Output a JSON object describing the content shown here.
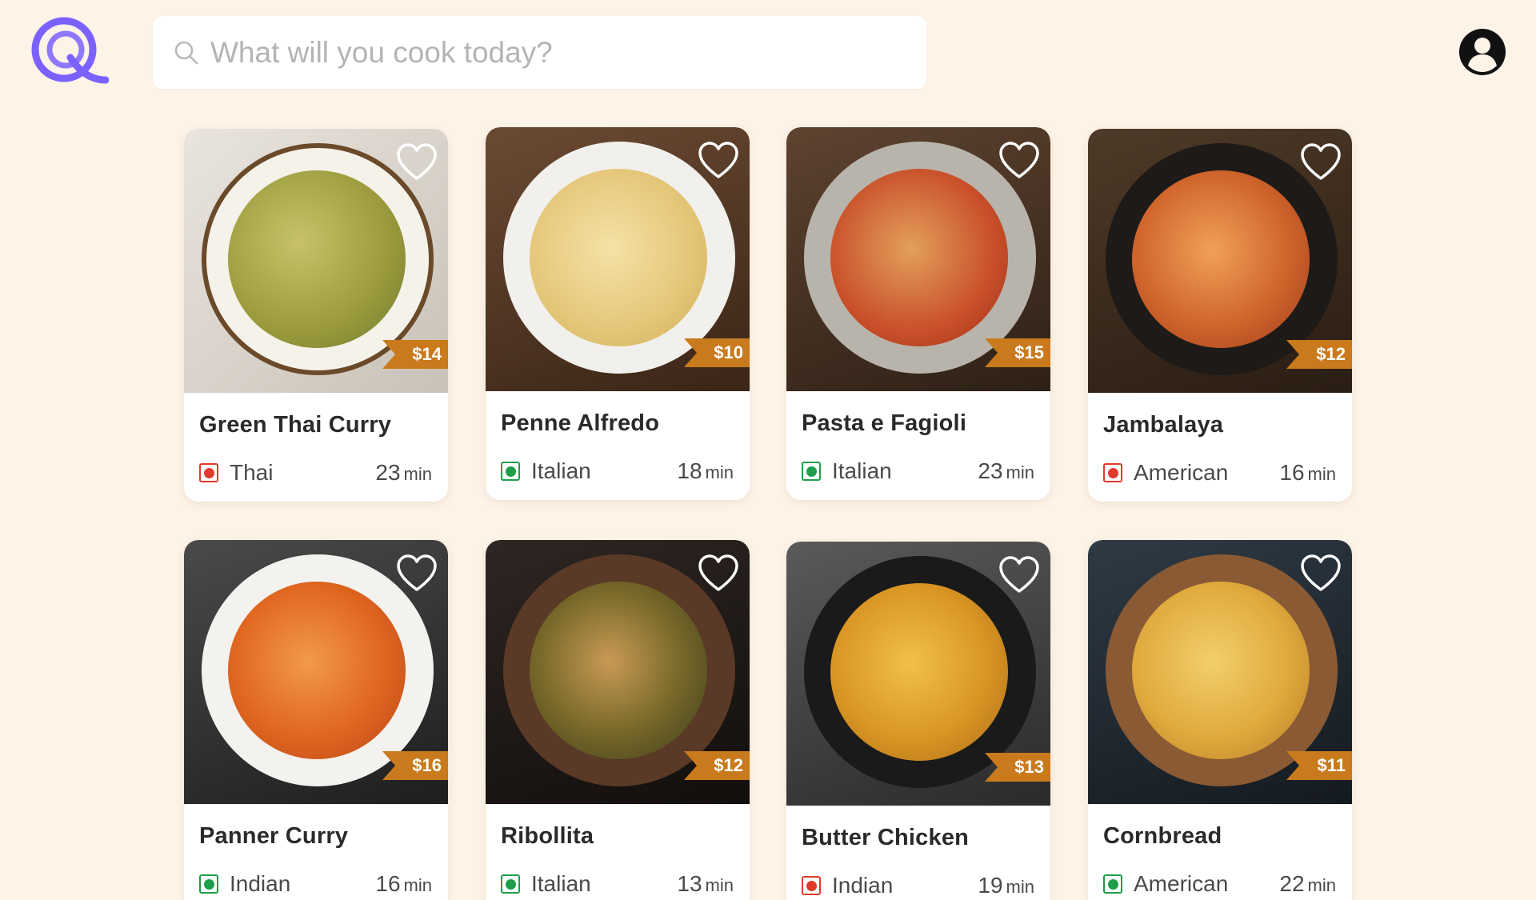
{
  "header": {
    "logo_icon": "q-logo-icon",
    "search": {
      "placeholder": "What will you cook today?",
      "icon": "search-icon"
    },
    "account_icon": "user-account-icon"
  },
  "colors": {
    "background": "#fdf3e7",
    "brand": "#7b61ff",
    "price_tag": "#c97a1c",
    "veg": "#1e9e4a",
    "non_veg": "#e03a2b"
  },
  "recipes": [
    {
      "name": "Green Thai Curry",
      "cuisine": "Thai",
      "time": "23",
      "time_unit": "min",
      "price": "$14",
      "diet": "non-veg",
      "photo": "green-curry-photo"
    },
    {
      "name": "Penne Alfredo",
      "cuisine": "Italian",
      "time": "18",
      "time_unit": "min",
      "price": "$10",
      "diet": "veg",
      "photo": "penne-alfredo-photo"
    },
    {
      "name": "Pasta e Fagioli",
      "cuisine": "Italian",
      "time": "23",
      "time_unit": "min",
      "price": "$15",
      "diet": "veg",
      "photo": "pasta-fagioli-photo"
    },
    {
      "name": "Jambalaya",
      "cuisine": "American",
      "time": "16",
      "time_unit": "min",
      "price": "$12",
      "diet": "non-veg",
      "photo": "jambalaya-photo"
    },
    {
      "name": "Panner Curry",
      "cuisine": "Indian",
      "time": "16",
      "time_unit": "min",
      "price": "$16",
      "diet": "veg",
      "photo": "paneer-curry-photo"
    },
    {
      "name": "Ribollita",
      "cuisine": "Italian",
      "time": "13",
      "time_unit": "min",
      "price": "$12",
      "diet": "veg",
      "photo": "ribollita-photo"
    },
    {
      "name": "Butter Chicken",
      "cuisine": "Indian",
      "time": "19",
      "time_unit": "min",
      "price": "$13",
      "diet": "non-veg",
      "photo": "butter-chicken-photo"
    },
    {
      "name": "Cornbread",
      "cuisine": "American",
      "time": "22",
      "time_unit": "min",
      "price": "$11",
      "diet": "veg",
      "photo": "cornbread-photo"
    }
  ]
}
